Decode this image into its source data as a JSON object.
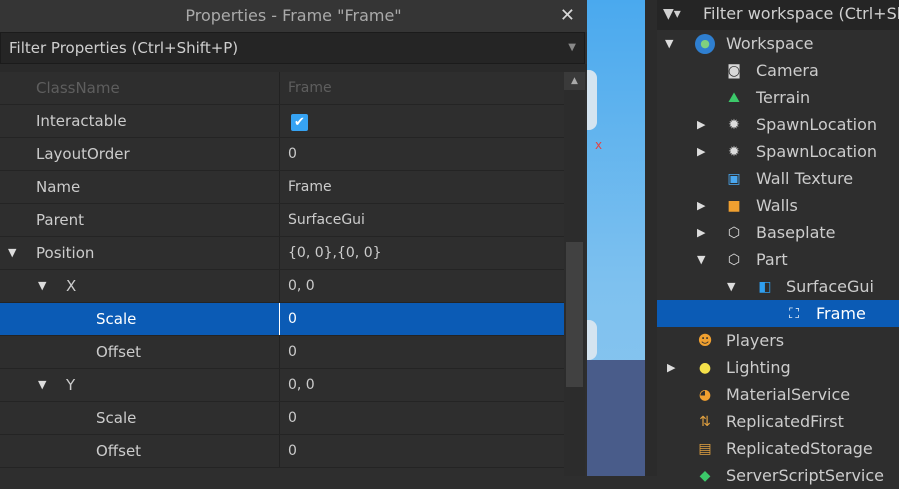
{
  "properties": {
    "title": "Properties - Frame \"Frame\"",
    "close": "✕",
    "filter_placeholder": "Filter Properties (Ctrl+Shift+P)",
    "rows": [
      {
        "name": "ClassName",
        "value": "Frame"
      },
      {
        "name": "Interactable",
        "value": "✔"
      },
      {
        "name": "LayoutOrder",
        "value": "0"
      },
      {
        "name": "Name",
        "value": "Frame"
      },
      {
        "name": "Parent",
        "value": "SurfaceGui"
      },
      {
        "name": "Position",
        "value": "{0, 0},{0, 0}"
      },
      {
        "name": "X",
        "value": "0, 0"
      },
      {
        "name": "Scale",
        "value": "0"
      },
      {
        "name": "Offset",
        "value": "0"
      },
      {
        "name": "Y",
        "value": "0, 0"
      },
      {
        "name": "Scale",
        "value": "0"
      },
      {
        "name": "Offset",
        "value": "0"
      }
    ]
  },
  "explorer": {
    "filter_placeholder": "Filter workspace (Ctrl+Shift",
    "items": [
      {
        "label": "Workspace",
        "icon": "workspace-icon"
      },
      {
        "label": "Camera",
        "icon": "camera-icon"
      },
      {
        "label": "Terrain",
        "icon": "terrain-icon"
      },
      {
        "label": "SpawnLocation",
        "icon": "spawn-icon"
      },
      {
        "label": "SpawnLocation",
        "icon": "spawn-icon"
      },
      {
        "label": "Wall Texture",
        "icon": "texture-icon"
      },
      {
        "label": "Walls",
        "icon": "model-icon"
      },
      {
        "label": "Baseplate",
        "icon": "part-icon"
      },
      {
        "label": "Part",
        "icon": "part-icon"
      },
      {
        "label": "SurfaceGui",
        "icon": "surfacegui-icon"
      },
      {
        "label": "Frame",
        "icon": "frame-icon"
      },
      {
        "label": "Players",
        "icon": "players-icon"
      },
      {
        "label": "Lighting",
        "icon": "lighting-icon"
      },
      {
        "label": "MaterialService",
        "icon": "material-icon"
      },
      {
        "label": "ReplicatedFirst",
        "icon": "replicated-first-icon"
      },
      {
        "label": "ReplicatedStorage",
        "icon": "replicated-storage-icon"
      },
      {
        "label": "ServerScriptService",
        "icon": "server-script-icon"
      }
    ]
  },
  "colors": {
    "selection": "#0b5bb5",
    "checkbox": "#36a3f3"
  }
}
